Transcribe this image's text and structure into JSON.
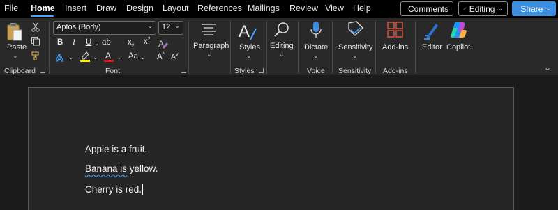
{
  "menu": {
    "tabs": [
      "File",
      "Home",
      "Insert",
      "Draw",
      "Design",
      "Layout",
      "References",
      "Mailings",
      "Review",
      "View",
      "Help"
    ],
    "active_tab": "Home",
    "comments_label": "Comments",
    "editing_label": "Editing",
    "share_label": "Share"
  },
  "ribbon": {
    "clipboard": {
      "paste_label": "Paste",
      "group_label": "Clipboard"
    },
    "font": {
      "font_name": "Aptos (Body)",
      "font_size": "12",
      "bold": "B",
      "italic": "I",
      "underline": "U",
      "strike": "ab",
      "subscript": "x",
      "superscript": "x",
      "grow": "A",
      "shrink": "A",
      "case": "Aa",
      "group_label": "Font"
    },
    "paragraph": {
      "label": "Paragraph"
    },
    "styles": {
      "label": "Styles",
      "group_label": "Styles"
    },
    "editing": {
      "label": "Editing"
    },
    "voice": {
      "dictate_label": "Dictate",
      "group_label": "Voice"
    },
    "sensitivity": {
      "label": "Sensitivity",
      "group_label": "Sensitivity"
    },
    "addins": {
      "label": "Add-ins",
      "group_label": "Add-ins"
    },
    "editor": {
      "label": "Editor"
    },
    "copilot": {
      "label": "Copilot"
    },
    "colors": {
      "accent": "#4ca3ff",
      "highlight": "#ffef00",
      "font_color": "#e81123",
      "share": "#3b8ee0"
    }
  },
  "document": {
    "lines": [
      {
        "text": "Apple is a fruit."
      },
      {
        "squiggle": "Banana is",
        "rest": " yellow."
      },
      {
        "text": "Cherry is red."
      }
    ]
  }
}
